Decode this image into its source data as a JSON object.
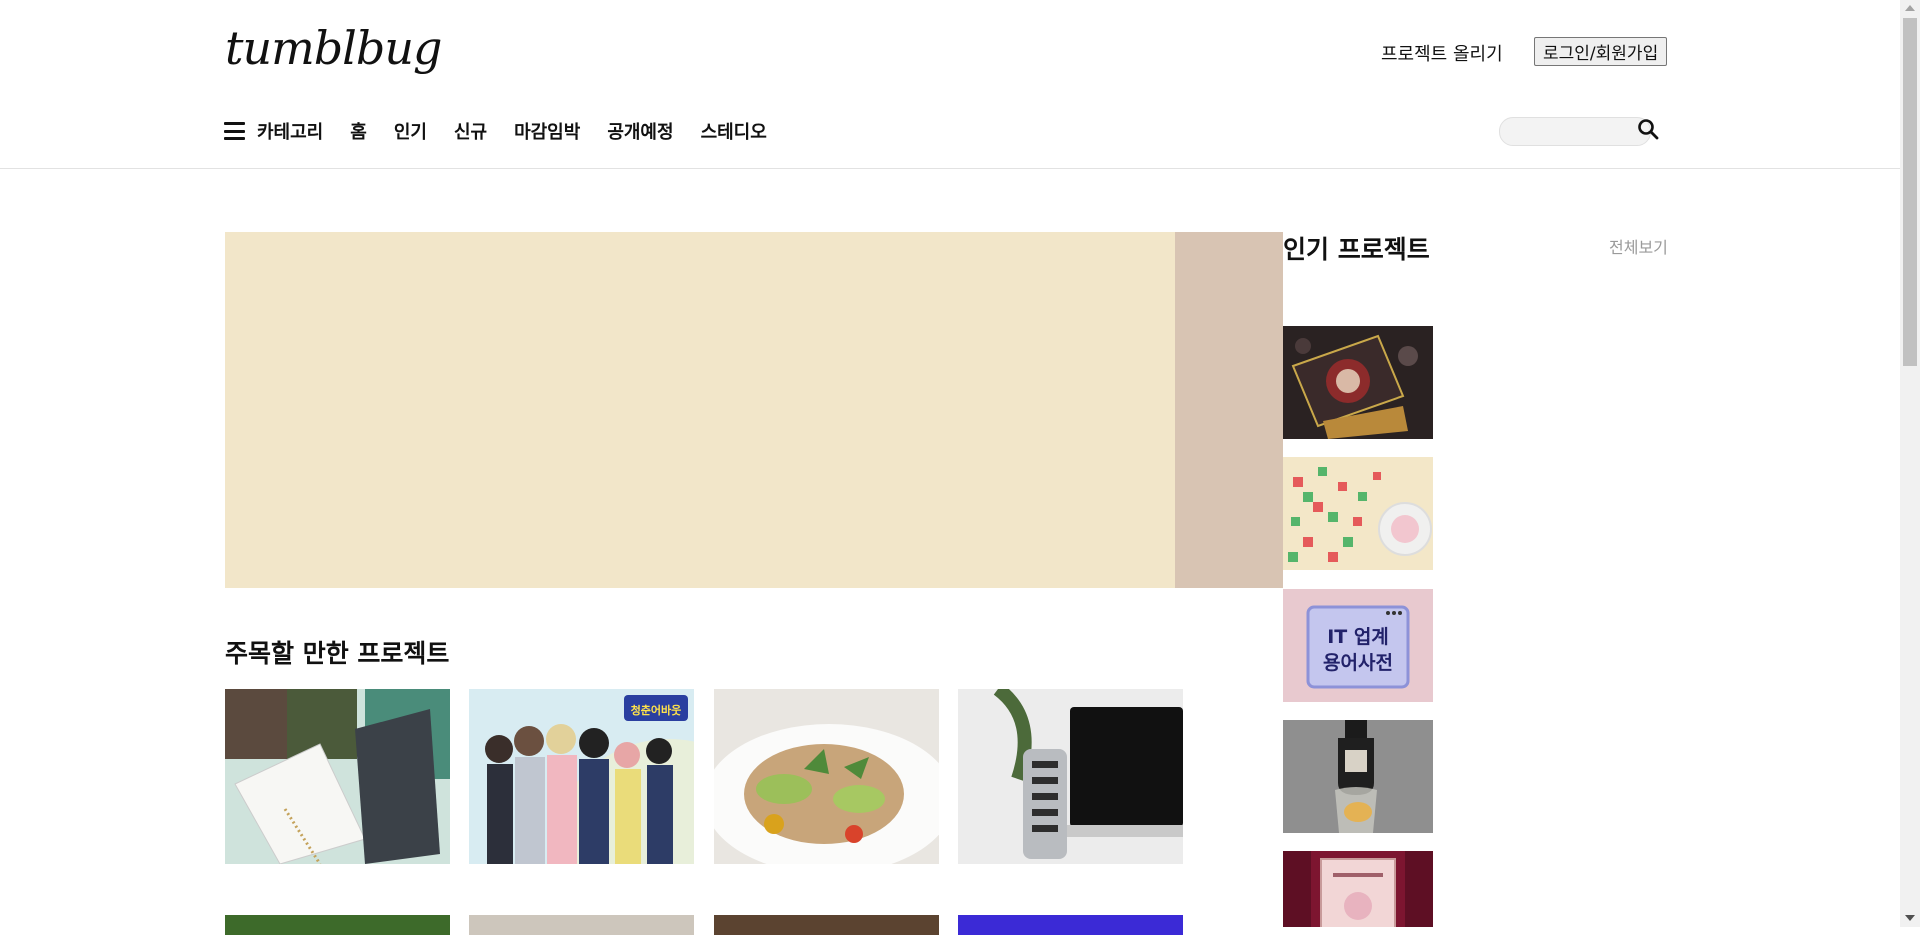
{
  "header": {
    "logo": "tumblbug",
    "upload_label": "프로젝트 올리기",
    "login_label": "로그인/회원가입"
  },
  "nav": {
    "items": [
      "카테고리",
      "홈",
      "인기",
      "신규",
      "마감임박",
      "공개예정",
      "스테디오"
    ]
  },
  "search": {
    "placeholder": ""
  },
  "popular": {
    "title": "인기 프로젝트",
    "see_all": "전체보기",
    "thumbnails": [
      {
        "icon": "card-deck-image"
      },
      {
        "icon": "candy-cubes-image"
      },
      {
        "icon": "it-dictionary-image",
        "text_line1": "IT 업계",
        "text_line2": "용어사전"
      },
      {
        "icon": "perfume-bottle-image"
      },
      {
        "icon": "theater-poster-image"
      }
    ]
  },
  "featured": {
    "title": "주목할 만한 프로젝트",
    "cards": [
      {
        "icon": "planner-notebooks-image"
      },
      {
        "icon": "webtoon-characters-image",
        "badge": "청춘어바웃"
      },
      {
        "icon": "salad-plate-image"
      },
      {
        "icon": "usb-hub-laptop-image"
      }
    ]
  },
  "colors": {
    "banner_main": "#f2e6c9",
    "banner_side": "#d8c4b3",
    "accent": "#111111"
  }
}
